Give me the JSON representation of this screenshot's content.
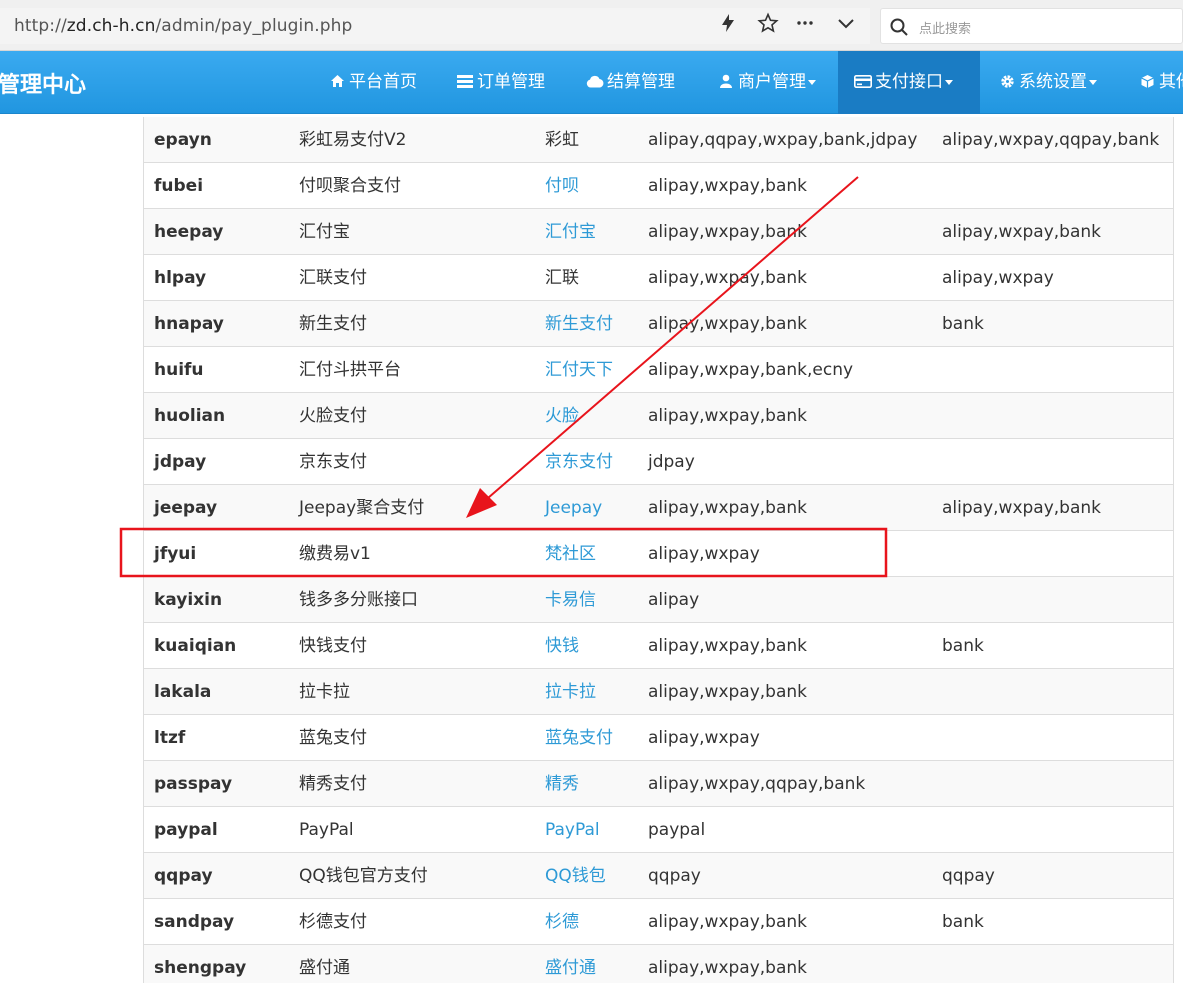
{
  "browser": {
    "url_prefix": "http://",
    "url_host": "zd.ch-h.cn",
    "url_path": "/admin/pay_plugin.php",
    "search_placeholder": "点此搜索"
  },
  "header": {
    "brand": "管理中心",
    "nav": [
      {
        "label": "平台首页",
        "icon": "home-icon",
        "dropdown": false
      },
      {
        "label": "订单管理",
        "icon": "list-icon",
        "dropdown": false
      },
      {
        "label": "结算管理",
        "icon": "cloud-icon",
        "dropdown": false
      },
      {
        "label": "商户管理",
        "icon": "user-icon",
        "dropdown": true
      },
      {
        "label": "支付接口",
        "icon": "credit-card-icon",
        "dropdown": true,
        "active": true
      },
      {
        "label": "系统设置",
        "icon": "gear-icon",
        "dropdown": true
      },
      {
        "label": "其他",
        "icon": "cube-icon",
        "dropdown": false
      }
    ]
  },
  "table": {
    "rows": [
      {
        "code": "epayn",
        "name": "彩虹易支付V2",
        "author": "彩虹",
        "author_link": false,
        "types": "alipay,qqpay,wxpay,bank,jdpay",
        "transfer": "alipay,wxpay,qqpay,bank"
      },
      {
        "code": "fubei",
        "name": "付呗聚合支付",
        "author": "付呗",
        "author_link": true,
        "types": "alipay,wxpay,bank",
        "transfer": ""
      },
      {
        "code": "heepay",
        "name": "汇付宝",
        "author": "汇付宝",
        "author_link": true,
        "types": "alipay,wxpay,bank",
        "transfer": "alipay,wxpay,bank"
      },
      {
        "code": "hlpay",
        "name": "汇联支付",
        "author": "汇联",
        "author_link": false,
        "types": "alipay,wxpay,bank",
        "transfer": "alipay,wxpay"
      },
      {
        "code": "hnapay",
        "name": "新生支付",
        "author": "新生支付",
        "author_link": true,
        "types": "alipay,wxpay,bank",
        "transfer": "bank"
      },
      {
        "code": "huifu",
        "name": "汇付斗拱平台",
        "author": "汇付天下",
        "author_link": true,
        "types": "alipay,wxpay,bank,ecny",
        "transfer": ""
      },
      {
        "code": "huolian",
        "name": "火脸支付",
        "author": "火脸",
        "author_link": true,
        "types": "alipay,wxpay,bank",
        "transfer": ""
      },
      {
        "code": "jdpay",
        "name": "京东支付",
        "author": "京东支付",
        "author_link": true,
        "types": "jdpay",
        "transfer": ""
      },
      {
        "code": "jeepay",
        "name": "Jeepay聚合支付",
        "author": "Jeepay",
        "author_link": true,
        "types": "alipay,wxpay,bank",
        "transfer": "alipay,wxpay,bank"
      },
      {
        "code": "jfyui",
        "name": "缴费易v1",
        "author": "梵社区",
        "author_link": true,
        "types": "alipay,wxpay",
        "transfer": ""
      },
      {
        "code": "kayixin",
        "name": "钱多多分账接口",
        "author": "卡易信",
        "author_link": true,
        "types": "alipay",
        "transfer": ""
      },
      {
        "code": "kuaiqian",
        "name": "快钱支付",
        "author": "快钱",
        "author_link": true,
        "types": "alipay,wxpay,bank",
        "transfer": "bank"
      },
      {
        "code": "lakala",
        "name": "拉卡拉",
        "author": "拉卡拉",
        "author_link": true,
        "types": "alipay,wxpay,bank",
        "transfer": ""
      },
      {
        "code": "ltzf",
        "name": "蓝兔支付",
        "author": "蓝兔支付",
        "author_link": true,
        "types": "alipay,wxpay",
        "transfer": ""
      },
      {
        "code": "passpay",
        "name": "精秀支付",
        "author": "精秀",
        "author_link": true,
        "types": "alipay,wxpay,qqpay,bank",
        "transfer": ""
      },
      {
        "code": "paypal",
        "name": "PayPal",
        "author": "PayPal",
        "author_link": true,
        "types": "paypal",
        "transfer": ""
      },
      {
        "code": "qqpay",
        "name": "QQ钱包官方支付",
        "author": "QQ钱包",
        "author_link": true,
        "types": "qqpay",
        "transfer": "qqpay"
      },
      {
        "code": "sandpay",
        "name": "杉德支付",
        "author": "杉德",
        "author_link": true,
        "types": "alipay,wxpay,bank",
        "transfer": "bank"
      },
      {
        "code": "shengpay",
        "name": "盛付通",
        "author": "盛付通",
        "author_link": true,
        "types": "alipay,wxpay,bank",
        "transfer": ""
      }
    ]
  },
  "annotation": {
    "highlight_color": "#e8141c",
    "highlighted_row": "jfyui"
  }
}
